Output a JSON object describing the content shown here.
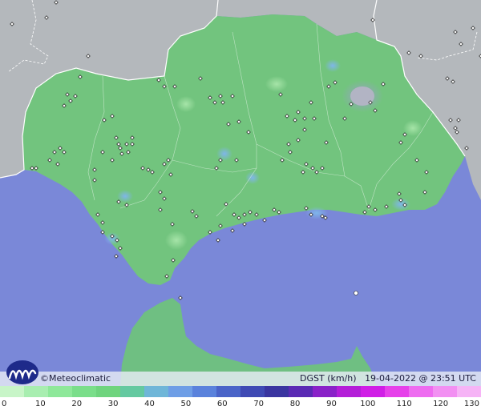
{
  "brand": {
    "name": "Meteoclimatic",
    "copyright": "©"
  },
  "map": {
    "variable": "DGST (km/h)",
    "datetime": "19-04-2022 @ 23:51 UTC"
  },
  "legend": {
    "ticks": [
      "0",
      "10",
      "20",
      "30",
      "40",
      "50",
      "60",
      "70",
      "80",
      "90",
      "100",
      "110",
      "120",
      "130"
    ],
    "colors": [
      "#c8f5c8",
      "#a8eeb0",
      "#8ee89a",
      "#7ade8a",
      "#6fd47e",
      "#64c9a0",
      "#6fb6d8",
      "#6e9ee6",
      "#5a82dc",
      "#4a64c8",
      "#3f4ab4",
      "#3a35a0",
      "#5a2ab4",
      "#8a22c8",
      "#b41ed8",
      "#d01ee6",
      "#e640ea",
      "#ee6cf0",
      "#f290f2",
      "#f6b4f6"
    ]
  },
  "colors": {
    "sea": "#7a88d8",
    "land_data": "#72c47e",
    "land_outside": "#b4b8bc",
    "border": "#ffffff"
  },
  "icons": {
    "brand_logo": "meteoclimatic-logo-icon"
  }
}
